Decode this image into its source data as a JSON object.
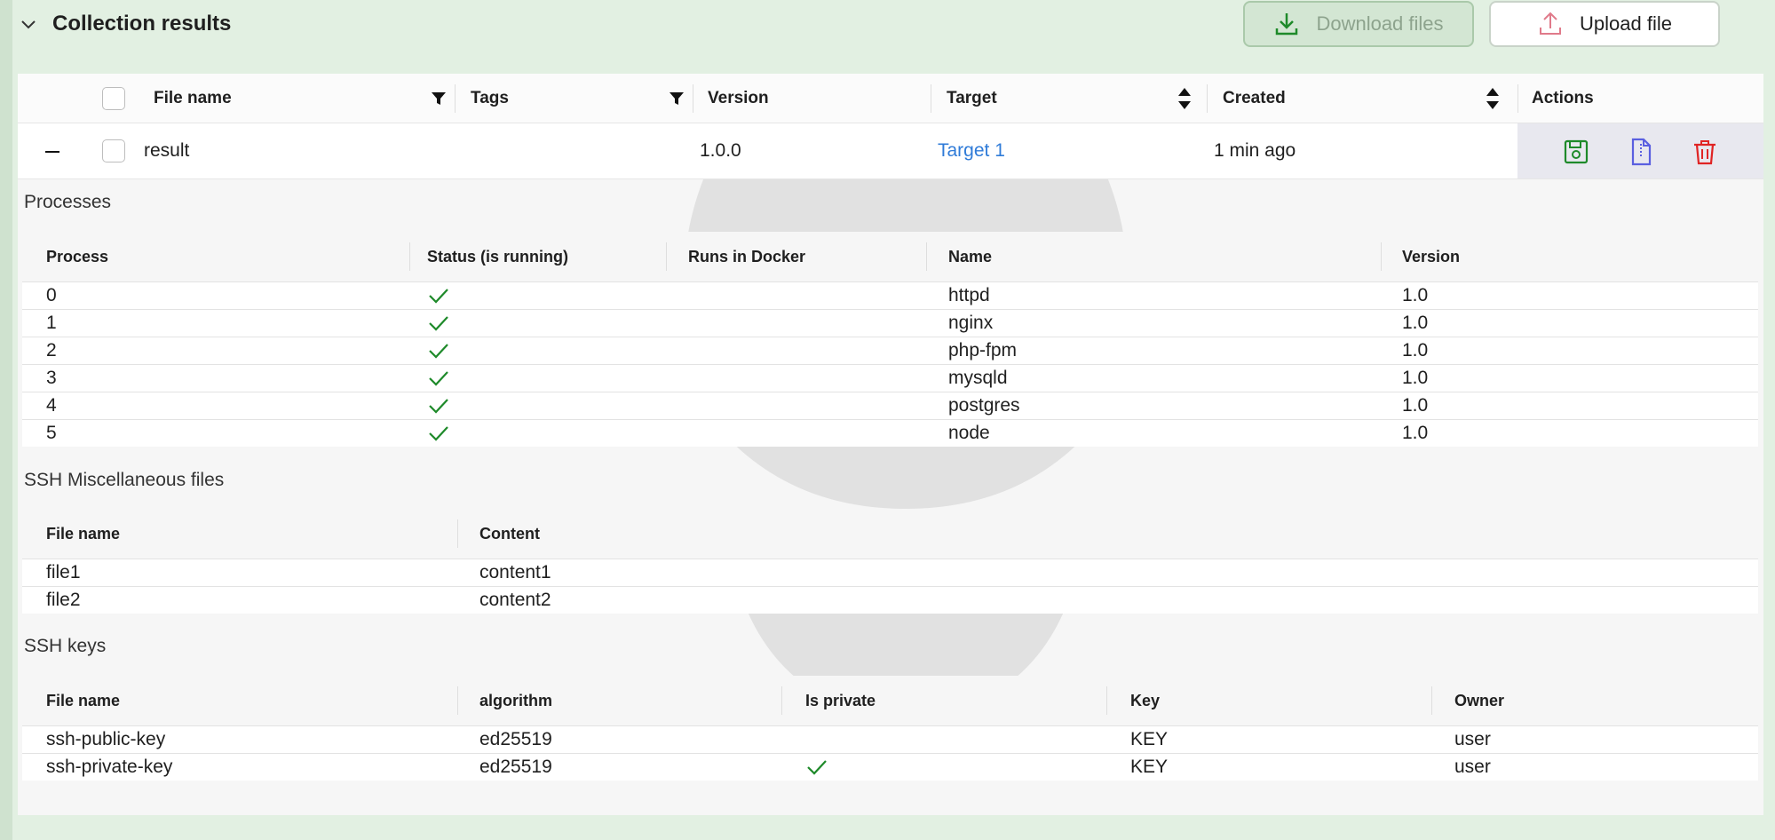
{
  "header": {
    "title": "Collection results",
    "download_label": "Download files",
    "upload_label": "Upload file"
  },
  "colors": {
    "accent_green": "#1e8a2a",
    "link_blue": "#2f7bd8",
    "delete_red": "#e02424",
    "doc_blue": "#5a5fe0"
  },
  "main_table": {
    "columns": {
      "file_name": "File name",
      "tags": "Tags",
      "version": "Version",
      "target": "Target",
      "created": "Created",
      "actions": "Actions"
    },
    "row": {
      "file_name": "result",
      "version": "1.0.0",
      "target": "Target 1",
      "created": "1 min ago",
      "actions": [
        "save-icon",
        "document-icon",
        "trash-icon"
      ]
    }
  },
  "processes": {
    "title": "Processes",
    "columns": [
      "Process",
      "Status (is running)",
      "Runs in Docker",
      "Name",
      "Version"
    ],
    "rows": [
      {
        "process": "0",
        "running": true,
        "docker": false,
        "name": "httpd",
        "version": "1.0"
      },
      {
        "process": "1",
        "running": true,
        "docker": false,
        "name": "nginx",
        "version": "1.0"
      },
      {
        "process": "2",
        "running": true,
        "docker": false,
        "name": "php-fpm",
        "version": "1.0"
      },
      {
        "process": "3",
        "running": true,
        "docker": false,
        "name": "mysqld",
        "version": "1.0"
      },
      {
        "process": "4",
        "running": true,
        "docker": false,
        "name": "postgres",
        "version": "1.0"
      },
      {
        "process": "5",
        "running": true,
        "docker": false,
        "name": "node",
        "version": "1.0"
      }
    ]
  },
  "misc_files": {
    "title": "SSH Miscellaneous files",
    "columns": [
      "File name",
      "Content"
    ],
    "rows": [
      {
        "file_name": "file1",
        "content": "content1"
      },
      {
        "file_name": "file2",
        "content": "content2"
      }
    ]
  },
  "ssh_keys": {
    "title": "SSH keys",
    "columns": [
      "File name",
      "algorithm",
      "Is private",
      "Key",
      "Owner"
    ],
    "rows": [
      {
        "file_name": "ssh-public-key",
        "algorithm": "ed25519",
        "is_private": false,
        "key": "KEY",
        "owner": "user"
      },
      {
        "file_name": "ssh-private-key",
        "algorithm": "ed25519",
        "is_private": true,
        "key": "KEY",
        "owner": "user"
      }
    ]
  }
}
